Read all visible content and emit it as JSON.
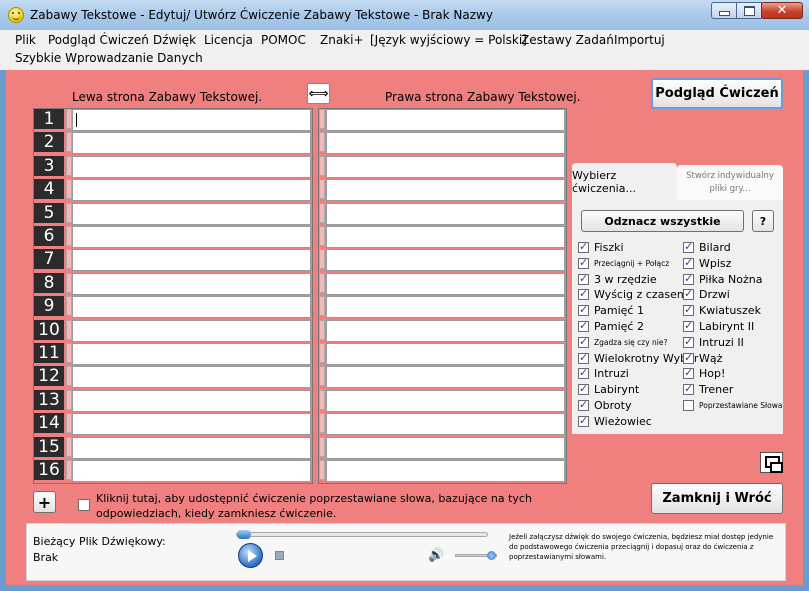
{
  "window": {
    "title": "Zabawy Tekstowe - Edytuj/ Utwórz Ćwiczenie Zabawy Tekstowe - Brak Nazwy"
  },
  "menu": {
    "items": [
      "Plik",
      "Podgląd Ćwiczeń",
      "Dźwięk",
      "Licencja",
      "POMOC",
      "Znaki+",
      "[Język wyjściowy = Polski]",
      "Zestawy Zadań",
      "Importuj"
    ],
    "second_row": "Szybkie Wprowadzanie Danych"
  },
  "editor": {
    "left_heading": "Lewa strona Zabawy Tekstowej.",
    "right_heading": "Prawa strona Zabawy Tekstowej.",
    "row_numbers": [
      "1",
      "2",
      "3",
      "4",
      "5",
      "6",
      "7",
      "8",
      "9",
      "10",
      "11",
      "12",
      "13",
      "14",
      "15",
      "16"
    ]
  },
  "buttons": {
    "preview": "Podgląd Ćwiczeń",
    "close": "Zamknij i Wróć",
    "add": "+",
    "select_all": "Odznacz wszystkie",
    "help": "?"
  },
  "tabs": {
    "choose": "Wybierz ćwiczenia...",
    "create": "Stwórz indywidualny pliki gry..."
  },
  "exercises": {
    "left": [
      {
        "label": "Fiszki",
        "checked": true,
        "small": false
      },
      {
        "label": "Przeciągnij + Połącz",
        "checked": true,
        "small": true
      },
      {
        "label": "3 w rzędzie",
        "checked": true,
        "small": false
      },
      {
        "label": "Wyścig z czasem",
        "checked": true,
        "small": false
      },
      {
        "label": "Pamięć 1",
        "checked": true,
        "small": false
      },
      {
        "label": "Pamięć 2",
        "checked": true,
        "small": false
      },
      {
        "label": "Zgadza się czy nie?",
        "checked": true,
        "small": true
      },
      {
        "label": "Wielokrotny Wybór",
        "checked": true,
        "small": false
      },
      {
        "label": "Intruzi",
        "checked": true,
        "small": false
      },
      {
        "label": "Labirynt",
        "checked": true,
        "small": false
      },
      {
        "label": "Obroty",
        "checked": true,
        "small": false
      },
      {
        "label": "Wieżowiec",
        "checked": true,
        "small": false
      }
    ],
    "right": [
      {
        "label": "Bilard",
        "checked": true,
        "small": false
      },
      {
        "label": "Wpisz",
        "checked": true,
        "small": false
      },
      {
        "label": "Piłka Nożna",
        "checked": true,
        "small": false
      },
      {
        "label": "Drzwi",
        "checked": true,
        "small": false
      },
      {
        "label": "Kwiatuszek",
        "checked": true,
        "small": false
      },
      {
        "label": "Labirynt II",
        "checked": true,
        "small": false
      },
      {
        "label": "Intruzi II",
        "checked": true,
        "small": false
      },
      {
        "label": "Wąż",
        "checked": true,
        "small": false
      },
      {
        "label": "Hop!",
        "checked": true,
        "small": false
      },
      {
        "label": "Trener",
        "checked": true,
        "small": false
      },
      {
        "label": "Poprzestawiane Słowa",
        "checked": false,
        "small": true
      }
    ]
  },
  "share": {
    "text": "Kliknij tutaj, aby udostępnić ćwiczenie poprzestawiane słowa, bazujące na tych odpowiedziach, kiedy zamkniesz ćwiczenie.",
    "checked": false
  },
  "audio": {
    "label": "Bieżący Plik Dźwiękowy:",
    "value": "Brak",
    "note": "Jeżeli załączysz dźwięk do swojego ćwiczenia, będziesz miał dostęp jedynie do podstawowego ćwiczenia przeciągnij i dopasuj oraz do ćwiczenia z poprzestawianymi słowami."
  },
  "colors": {
    "workspace": "#f08080",
    "frame": "#6a9ccf"
  }
}
